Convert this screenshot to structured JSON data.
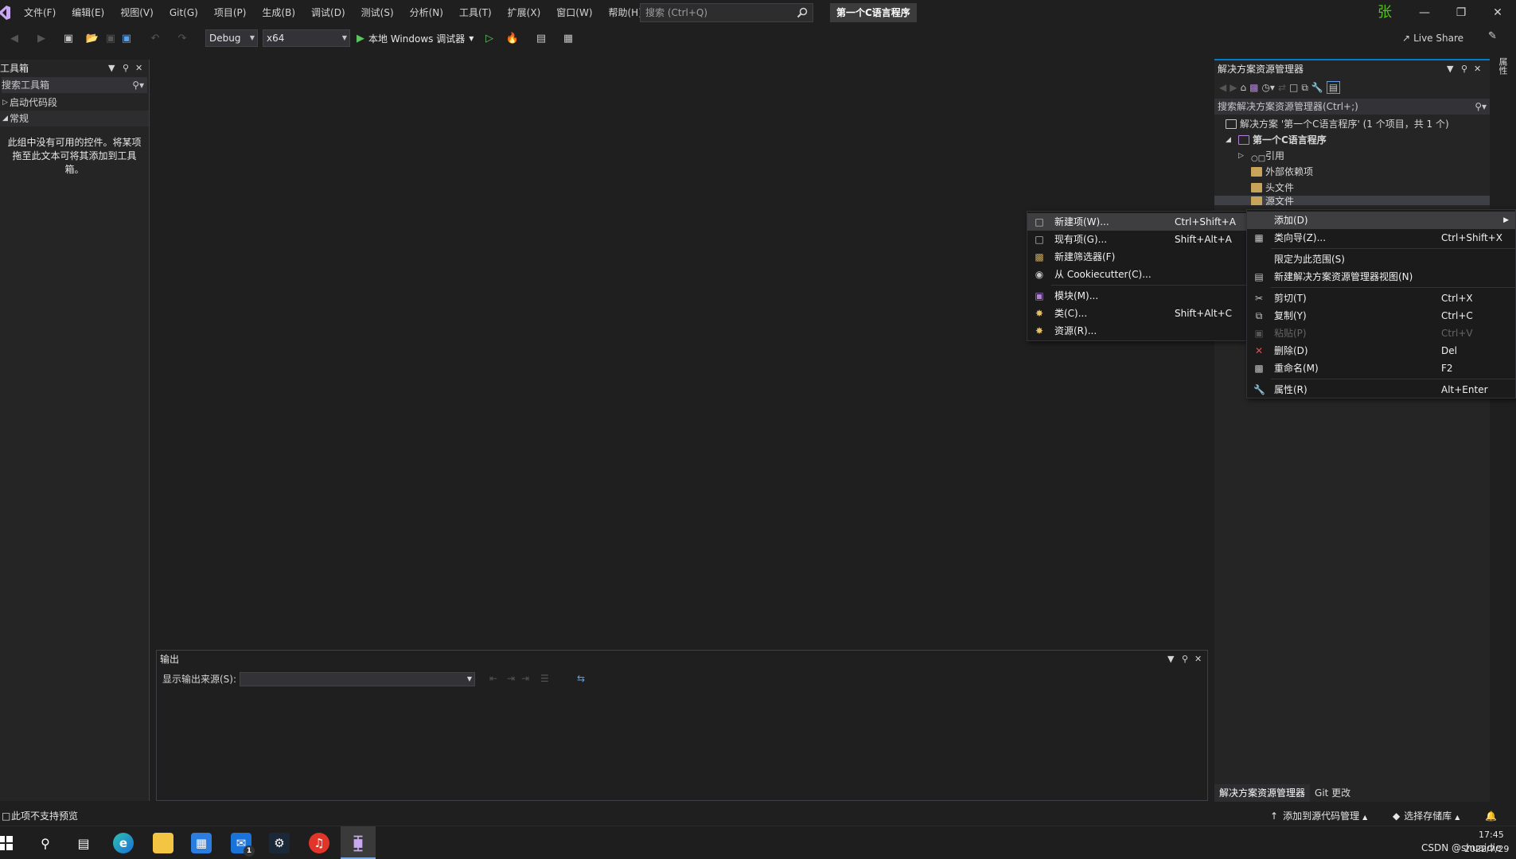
{
  "menubar": {
    "items": [
      "文件(F)",
      "编辑(E)",
      "视图(V)",
      "Git(G)",
      "项目(P)",
      "生成(B)",
      "调试(D)",
      "测试(S)",
      "分析(N)",
      "工具(T)",
      "扩展(X)",
      "窗口(W)",
      "帮助(H)"
    ],
    "search_placeholder": "搜索 (Ctrl+Q)",
    "solution_name": "第一个C语言程序",
    "user_initial": "张"
  },
  "toolbar": {
    "config": "Debug",
    "platform": "x64",
    "run_label": "本地 Windows 调试器",
    "live_share": "Live Share"
  },
  "toolbox": {
    "title": "工具箱",
    "search_placeholder": "搜索工具箱",
    "groups": [
      "启动代码段",
      "常规"
    ],
    "empty_message": "此组中没有可用的控件。将某项拖至此文本可将其添加到工具箱。"
  },
  "output": {
    "title": "输出",
    "source_label": "显示输出来源(S):"
  },
  "solution_explorer": {
    "title": "解决方案资源管理器",
    "search_placeholder": "搜索解决方案资源管理器(Ctrl+;)",
    "tree": [
      {
        "label": "解决方案 '第一个C语言程序' (1 个项目，共 1 个)",
        "level": 0,
        "icon": "solution-icon"
      },
      {
        "label": "第一个C语言程序",
        "level": 1,
        "icon": "project-icon",
        "bold": true
      },
      {
        "label": "引用",
        "level": 2,
        "icon": "reference-icon"
      },
      {
        "label": "外部依赖项",
        "level": 2,
        "icon": "folder-icon"
      },
      {
        "label": "头文件",
        "level": 2,
        "icon": "folder-icon"
      },
      {
        "label": "源文件",
        "level": 2,
        "icon": "folder-icon",
        "selected": true
      }
    ],
    "tabs": [
      "解决方案资源管理器",
      "Git 更改"
    ]
  },
  "right_strip": {
    "label": "属性"
  },
  "context_menu": {
    "items": [
      {
        "label": "添加(D)",
        "shortcut": "",
        "icon": "",
        "submenu": true,
        "highlighted": true
      },
      {
        "label": "类向导(Z)...",
        "shortcut": "Ctrl+Shift+X",
        "icon": "class-wizard-icon"
      },
      {
        "sep": true
      },
      {
        "label": "限定为此范围(S)",
        "shortcut": "",
        "icon": ""
      },
      {
        "label": "新建解决方案资源管理器视图(N)",
        "shortcut": "",
        "icon": "new-view-icon"
      },
      {
        "sep": true
      },
      {
        "label": "剪切(T)",
        "shortcut": "Ctrl+X",
        "icon": "cut-icon"
      },
      {
        "label": "复制(Y)",
        "shortcut": "Ctrl+C",
        "icon": "copy-icon"
      },
      {
        "label": "粘贴(P)",
        "shortcut": "Ctrl+V",
        "icon": "paste-icon",
        "disabled": true
      },
      {
        "label": "删除(D)",
        "shortcut": "Del",
        "icon": "delete-icon"
      },
      {
        "label": "重命名(M)",
        "shortcut": "F2",
        "icon": "rename-icon"
      },
      {
        "sep": true
      },
      {
        "label": "属性(R)",
        "shortcut": "Alt+Enter",
        "icon": "wrench-icon"
      }
    ]
  },
  "add_submenu": {
    "items": [
      {
        "label": "新建项(W)...",
        "shortcut": "Ctrl+Shift+A",
        "icon": "new-item-icon",
        "highlighted": true
      },
      {
        "label": "现有项(G)...",
        "shortcut": "Shift+Alt+A",
        "icon": "existing-item-icon"
      },
      {
        "label": "新建筛选器(F)",
        "shortcut": "",
        "icon": "filter-folder-icon"
      },
      {
        "label": "从 Cookiecutter(C)...",
        "shortcut": "",
        "icon": "cookiecutter-icon"
      },
      {
        "sep": true
      },
      {
        "label": "模块(M)...",
        "shortcut": "",
        "icon": "module-icon"
      },
      {
        "label": "类(C)...",
        "shortcut": "Shift+Alt+C",
        "icon": "class-icon"
      },
      {
        "label": "资源(R)...",
        "shortcut": "",
        "icon": "resource-icon"
      }
    ]
  },
  "statusbar": {
    "left_text": "此项不支持预览",
    "source_control": "添加到源代码管理",
    "repo": "选择存储库"
  },
  "taskbar": {
    "clock_time": "17:45",
    "clock_date": "2022/7/29",
    "watermark": "CSDN @shuaidie",
    "mail_badge": "1"
  }
}
